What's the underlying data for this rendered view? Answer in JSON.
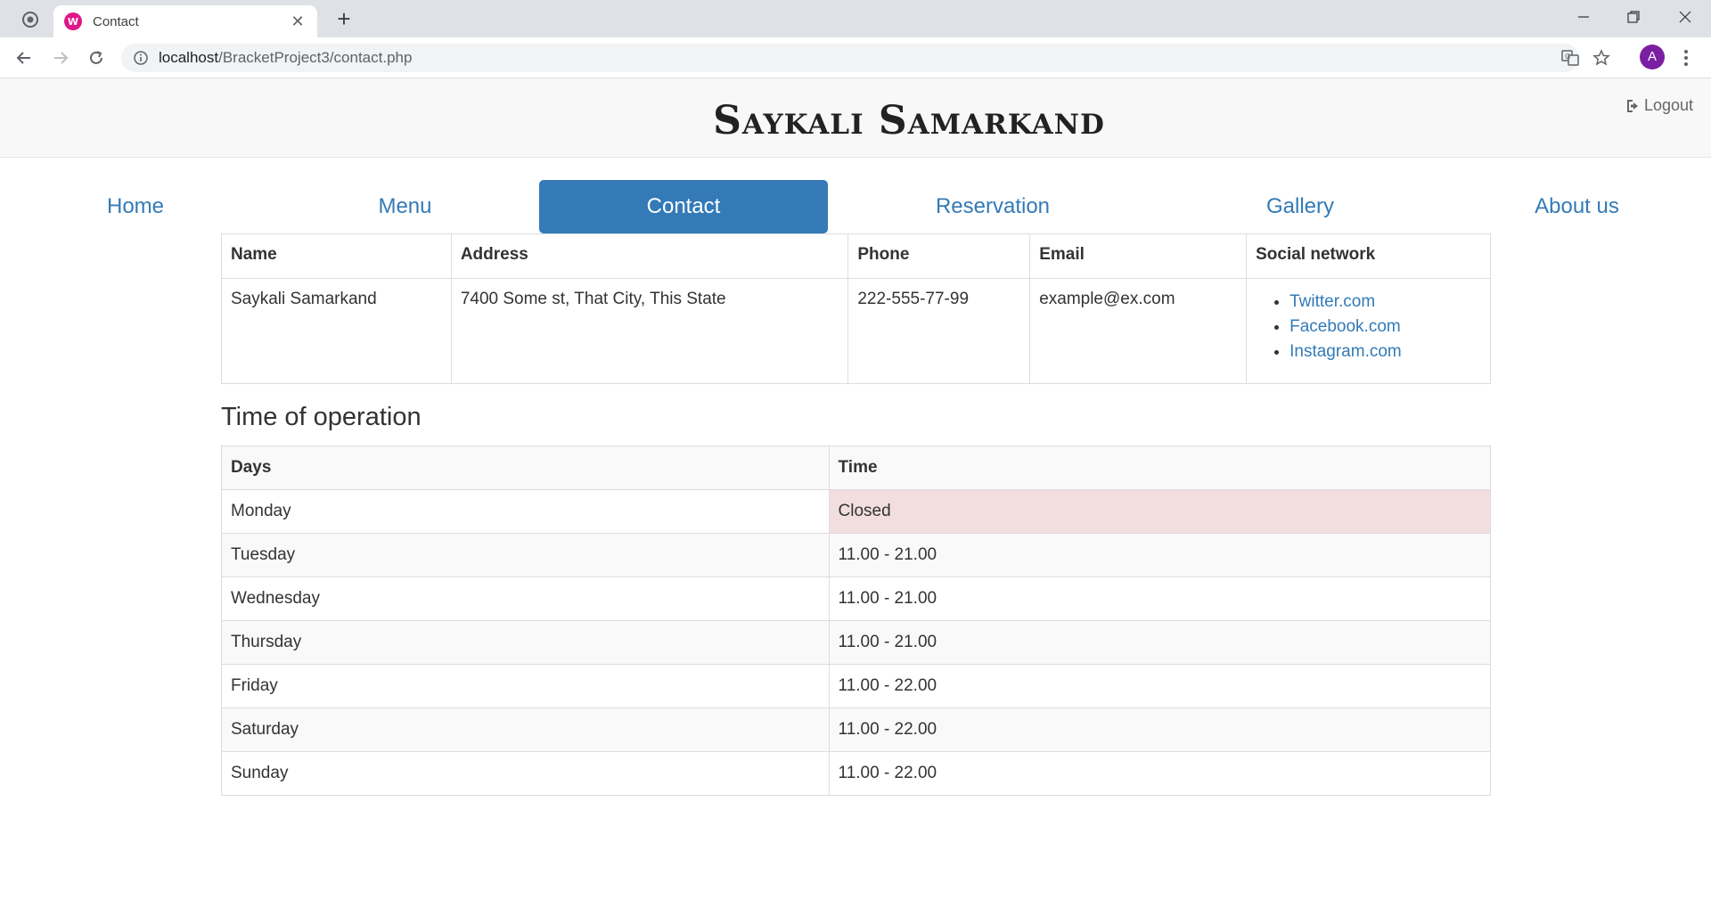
{
  "browser": {
    "tab_title": "Contact",
    "tab_favicon": "W",
    "url_host": "localhost",
    "url_path": "/BracketProject3/contact.php",
    "avatar_letter": "A"
  },
  "site": {
    "brand": "Saykali Samarkand",
    "logout_label": "Logout"
  },
  "nav": {
    "items": [
      {
        "label": "Home"
      },
      {
        "label": "Menu"
      },
      {
        "label": "Contact"
      },
      {
        "label": "Reservation"
      },
      {
        "label": "Gallery"
      },
      {
        "label": "About us"
      }
    ],
    "active": "Contact"
  },
  "contact": {
    "headers": [
      "Name",
      "Address",
      "Phone",
      "Email",
      "Social network"
    ],
    "name": "Saykali Samarkand",
    "address": "7400 Some st, That City, This State",
    "phone": "222-555-77-99",
    "email": "example@ex.com",
    "social": [
      "Twitter.com",
      "Facebook.com",
      "Instagram.com"
    ]
  },
  "hours": {
    "title": "Time of operation",
    "headers": [
      "Days",
      "Time"
    ],
    "rows": [
      {
        "day": "Monday",
        "time": "Closed"
      },
      {
        "day": "Tuesday",
        "time": "11.00 - 21.00"
      },
      {
        "day": "Wednesday",
        "time": "11.00 - 21.00"
      },
      {
        "day": "Thursday",
        "time": "11.00 - 21.00"
      },
      {
        "day": "Friday",
        "time": "11.00 - 22.00"
      },
      {
        "day": "Saturday",
        "time": "11.00 - 22.00"
      },
      {
        "day": "Sunday",
        "time": "11.00 - 22.00"
      }
    ]
  },
  "colors": {
    "link": "#337ab7",
    "active_nav_bg": "#337ab7",
    "closed_bg": "#f2dede",
    "header_bg": "#f8f8f8"
  }
}
